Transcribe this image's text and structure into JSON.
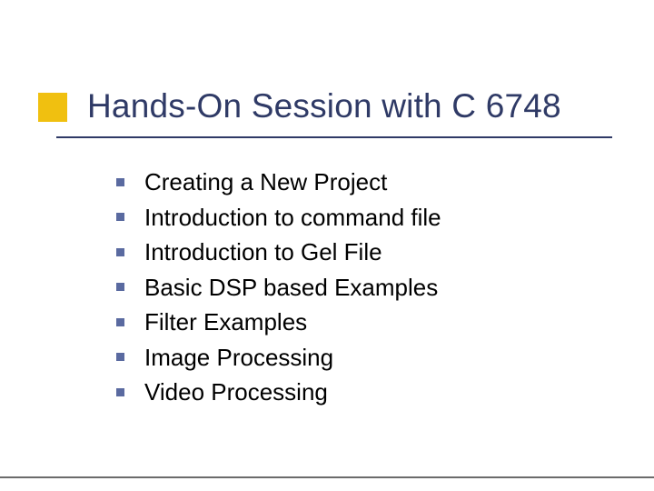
{
  "slide": {
    "title": "Hands-On Session with C 6748",
    "bullets": [
      "Creating a New Project",
      "Introduction to command file",
      "Introduction to Gel File",
      "Basic DSP based Examples",
      "Filter Examples",
      "Image Processing",
      "Video Processing"
    ]
  }
}
